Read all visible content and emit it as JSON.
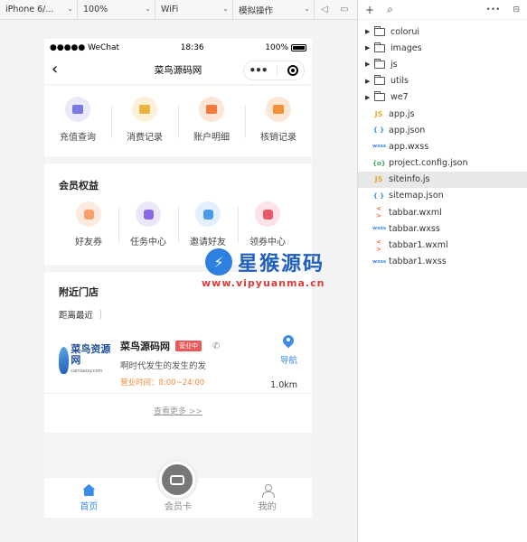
{
  "toolbar": {
    "device": "iPhone 6/...",
    "zoom": "100%",
    "network": "WiFi",
    "mode": "模拟操作"
  },
  "statusbar": {
    "carrier": "●●●●● WeChat",
    "time": "18:36",
    "battery": "100%"
  },
  "navbar": {
    "title": "菜鸟源码网"
  },
  "quick": [
    {
      "label": "充值查询",
      "color": "#7a7ae0",
      "bg": "#e9e9fa"
    },
    {
      "label": "消费记录",
      "color": "#e8b33a",
      "bg": "#fbf1d8"
    },
    {
      "label": "账户明细",
      "color": "#f07a3a",
      "bg": "#fde5d6"
    },
    {
      "label": "核销记录",
      "color": "#f0913a",
      "bg": "#fde7d4"
    }
  ],
  "rights": {
    "title": "会员权益",
    "items": [
      {
        "label": "好友券",
        "color": "#f5a06a",
        "bg": "#fdeadf"
      },
      {
        "label": "任务中心",
        "color": "#8a6ae0",
        "bg": "#ece6fb"
      },
      {
        "label": "邀请好友",
        "color": "#4a9ae8",
        "bg": "#e2effc"
      },
      {
        "label": "领券中心",
        "color": "#e85a6a",
        "bg": "#fde3e6"
      }
    ]
  },
  "stores": {
    "title": "附近门店",
    "sort": "距离最近",
    "items": [
      {
        "logo_text": "菜鸟资源网",
        "logo_sub": "cainiaozy.com",
        "name": "菜鸟源码网",
        "badge": "营业中",
        "desc": "啊时代发生的发生的发",
        "hours": "营业时间：8:00~24:00",
        "nav": "导航",
        "distance": "1.0km"
      }
    ],
    "more": "查看更多 >>"
  },
  "tabbar": {
    "home": "首页",
    "card": "会员卡",
    "mine": "我的"
  },
  "watermark": {
    "title": "星猴源码",
    "url": "www.vipyuanma.cn"
  },
  "explorer": {
    "folders": [
      "colorui",
      "images",
      "js",
      "utils",
      "we7"
    ],
    "files": [
      {
        "name": "app.js",
        "type": "JS",
        "cls": "js"
      },
      {
        "name": "app.json",
        "type": "{ }",
        "cls": "json"
      },
      {
        "name": "app.wxss",
        "type": "wxss",
        "cls": "wxss"
      },
      {
        "name": "project.config.json",
        "type": "{o}",
        "cls": "cfg"
      },
      {
        "name": "siteinfo.js",
        "type": "JS",
        "cls": "js",
        "selected": true
      },
      {
        "name": "sitemap.json",
        "type": "{ }",
        "cls": "json"
      },
      {
        "name": "tabbar.wxml",
        "type": "< >",
        "cls": "wxml"
      },
      {
        "name": "tabbar.wxss",
        "type": "wxss",
        "cls": "wxss"
      },
      {
        "name": "tabbar1.wxml",
        "type": "< >",
        "cls": "wxml"
      },
      {
        "name": "tabbar1.wxss",
        "type": "wxss",
        "cls": "wxss"
      }
    ]
  }
}
